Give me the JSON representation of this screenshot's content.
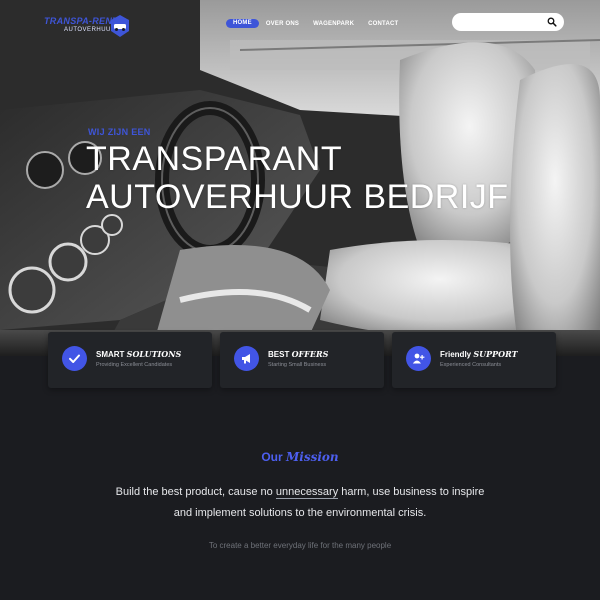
{
  "brand": {
    "name": "TRANSPA-RENT",
    "tagline": "AUTOVERHUUR"
  },
  "nav": [
    {
      "label": "HOME",
      "active": true
    },
    {
      "label": "OVER ONS",
      "active": false
    },
    {
      "label": "WAGENPARK",
      "active": false
    },
    {
      "label": "CONTACT",
      "active": false
    }
  ],
  "search": {
    "placeholder": "",
    "value": "",
    "icon": "search-icon"
  },
  "hero": {
    "kicker": "WIJ ZIJN EEN",
    "line1": "TRANSPARANT",
    "line2": "AUTOVERHUUR BEDRIJF"
  },
  "features": [
    {
      "icon": "check-icon",
      "title_plain": "SMART ",
      "title_italic": "SOLUTIONS",
      "subtitle": "Providing Excellent Candidates"
    },
    {
      "icon": "megaphone-icon",
      "title_plain": "BEST ",
      "title_italic": "OFFERS",
      "subtitle": "Starting Small Business"
    },
    {
      "icon": "add-user-icon",
      "title_plain": "Friendly ",
      "title_italic": "SUPPORT",
      "subtitle": "Experienced Consultants"
    }
  ],
  "mission": {
    "title_plain": "Our ",
    "title_italic": "Mission",
    "line1_a": "Build the best product, cause no ",
    "line1_u": "unnecessary",
    "line1_b": " harm, use business to inspire",
    "line2": "and implement solutions to the environmental crisis.",
    "footnote": "To create a better everyday life for the many people"
  },
  "colors": {
    "accent": "#3e55d8",
    "background": "#1b1c20",
    "card": "#222428"
  }
}
